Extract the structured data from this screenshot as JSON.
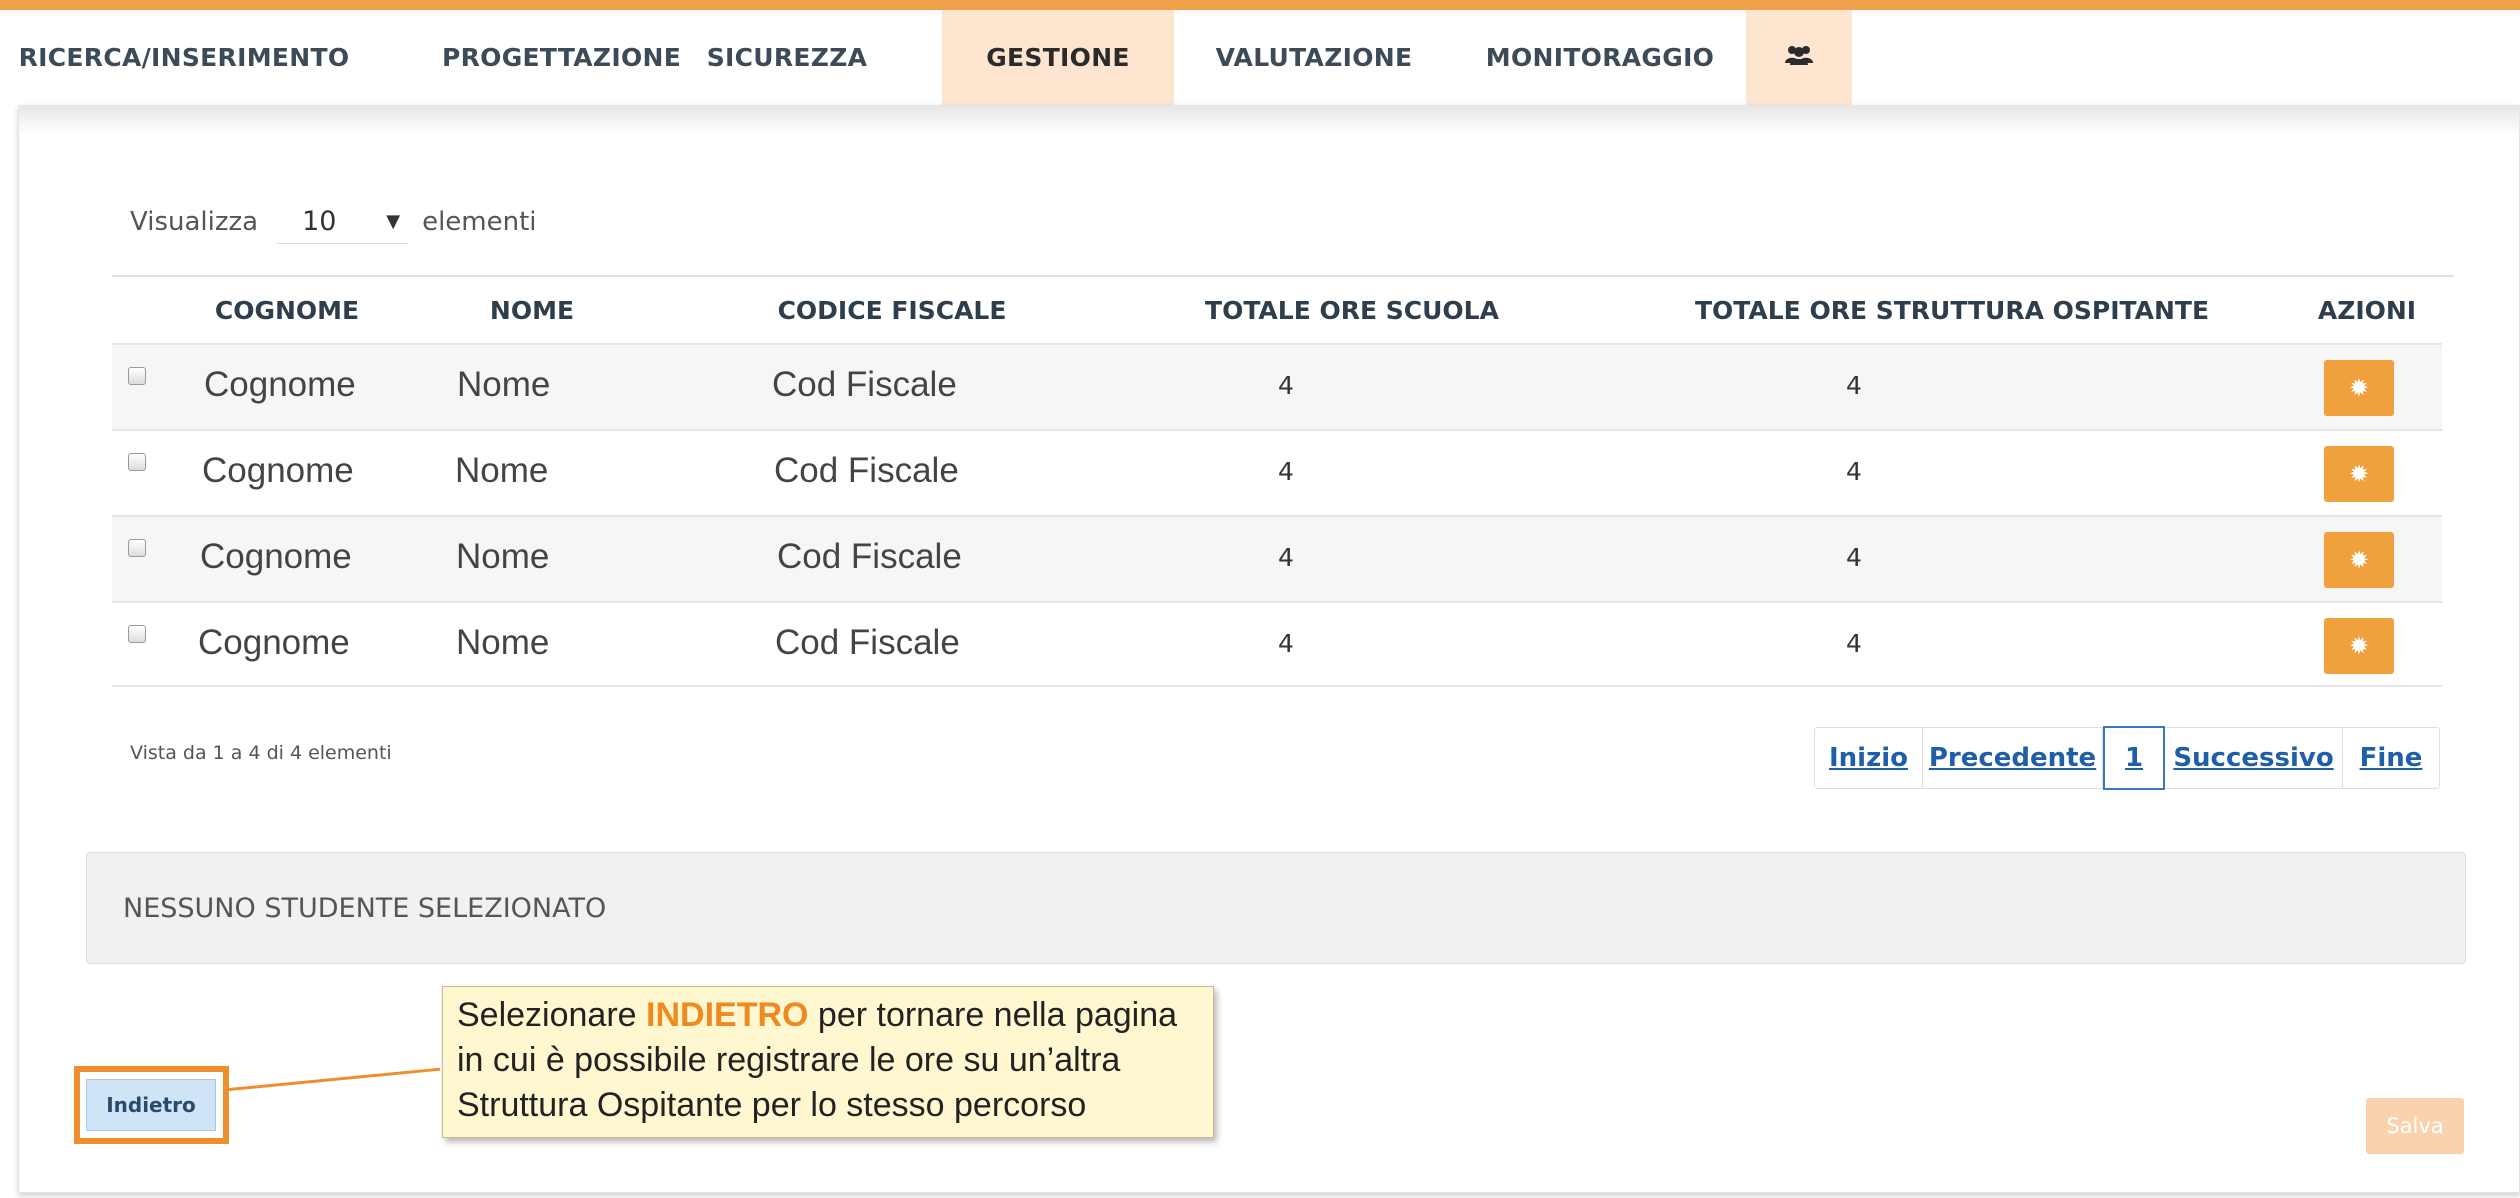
{
  "nav": {
    "tabs": [
      {
        "label": "RICERCA/INSERIMENTO"
      },
      {
        "label": "PROGETTAZIONE"
      },
      {
        "label": "SICUREZZA"
      },
      {
        "label": "GESTIONE",
        "active": true
      },
      {
        "label": "VALUTAZIONE"
      },
      {
        "label": "MONITORAGGIO"
      }
    ],
    "icon_tab": {
      "icon": "users-icon"
    }
  },
  "table_controls": {
    "show_label": "Visualizza",
    "page_length": "10",
    "entries_label": "elementi"
  },
  "table": {
    "columns": [
      "COGNOME",
      "NOME",
      "CODICE FISCALE",
      "TOTALE ORE SCUOLA",
      "TOTALE ORE STRUTTURA OSPITANTE",
      "AZIONI"
    ],
    "rows": [
      {
        "cognome": "Cognome",
        "nome": "Nome",
        "codice_fiscale": "Cod Fiscale",
        "ore_scuola": "4",
        "ore_struttura": "4"
      },
      {
        "cognome": "Cognome",
        "nome": "Nome",
        "codice_fiscale": "Cod Fiscale",
        "ore_scuola": "4",
        "ore_struttura": "4"
      },
      {
        "cognome": "Cognome",
        "nome": "Nome",
        "codice_fiscale": "Cod Fiscale",
        "ore_scuola": "4",
        "ore_struttura": "4"
      },
      {
        "cognome": "Cognome",
        "nome": "Nome",
        "codice_fiscale": "Cod Fiscale",
        "ore_scuola": "4",
        "ore_struttura": "4"
      }
    ],
    "action_icon": "gear-icon"
  },
  "info": "Vista da 1 a 4 di 4 elementi",
  "pagination": {
    "first": "Inizio",
    "previous": "Precedente",
    "current": "1",
    "next": "Successivo",
    "last": "Fine"
  },
  "selection_status": "NESSUNO STUDENTE SELEZIONATO",
  "buttons": {
    "back": "Indietro",
    "save": "Salva"
  },
  "callout": {
    "before": "Selezionare ",
    "keyword": "INDIETRO",
    "after": " per tornare nella pagina in cui è possibile registrare le ore su un’altra Struttura Ospitante per lo stesso percorso"
  },
  "colors": {
    "accent": "#f0a04b",
    "active_tab": "#fde5cf",
    "action_button": "#f0a03c",
    "link": "#1f5fa8"
  }
}
